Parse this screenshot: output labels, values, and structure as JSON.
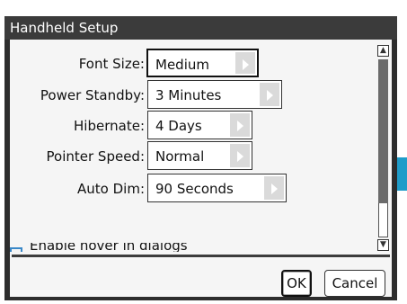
{
  "dialog": {
    "title": "Handheld Setup"
  },
  "settings": [
    {
      "label": "Font Size:",
      "value": "Medium"
    },
    {
      "label": "Power Standby:",
      "value": "3 Minutes"
    },
    {
      "label": "Hibernate:",
      "value": "4 Days"
    },
    {
      "label": "Pointer Speed:",
      "value": "Normal"
    },
    {
      "label": "Auto Dim:",
      "value": "90 Seconds"
    }
  ],
  "partial_option": {
    "label": "Enable hover in dialogs"
  },
  "buttons": {
    "ok": "OK",
    "cancel": "Cancel"
  },
  "icons": {
    "scroll_up": "▲",
    "scroll_down": "▼"
  },
  "colors": {
    "titlebar": "#3b3b3b",
    "panel": "#f5f5f5",
    "accent": "#1f9cc9"
  }
}
